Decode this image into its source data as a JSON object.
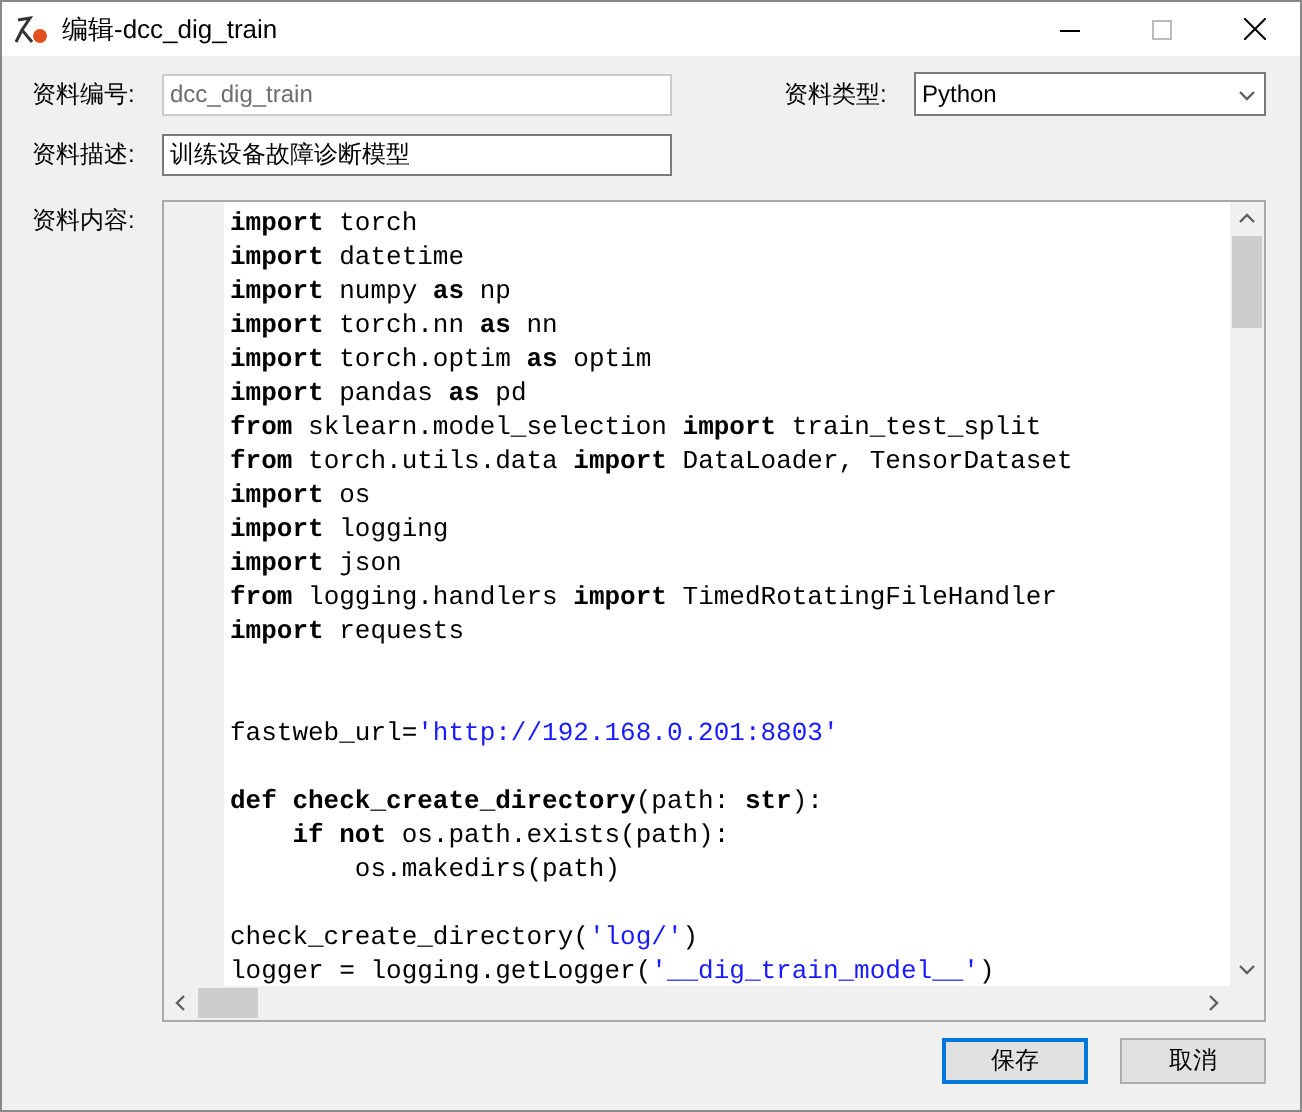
{
  "window": {
    "title": "编辑-dcc_dig_train"
  },
  "form": {
    "id_label": "资料编号:",
    "id_value": "dcc_dig_train",
    "id_disabled": true,
    "type_label": "资料类型:",
    "type_value": "Python",
    "desc_label": "资料描述:",
    "desc_value": "训练设备故障诊断模型",
    "content_label": "资料内容:"
  },
  "code_lines": [
    {
      "kind": "code",
      "tokens": [
        {
          "kind": "keyword",
          "text": "import"
        },
        {
          "kind": "plain",
          "text": " torch"
        }
      ]
    },
    {
      "kind": "code",
      "tokens": [
        {
          "kind": "keyword",
          "text": "import"
        },
        {
          "kind": "plain",
          "text": " datetime"
        }
      ]
    },
    {
      "kind": "code",
      "tokens": [
        {
          "kind": "keyword",
          "text": "import"
        },
        {
          "kind": "plain",
          "text": " numpy "
        },
        {
          "kind": "keyword",
          "text": "as"
        },
        {
          "kind": "plain",
          "text": " np"
        }
      ]
    },
    {
      "kind": "code",
      "tokens": [
        {
          "kind": "keyword",
          "text": "import"
        },
        {
          "kind": "plain",
          "text": " torch.nn "
        },
        {
          "kind": "keyword",
          "text": "as"
        },
        {
          "kind": "plain",
          "text": " nn"
        }
      ]
    },
    {
      "kind": "code",
      "tokens": [
        {
          "kind": "keyword",
          "text": "import"
        },
        {
          "kind": "plain",
          "text": " torch.optim "
        },
        {
          "kind": "keyword",
          "text": "as"
        },
        {
          "kind": "plain",
          "text": " optim"
        }
      ]
    },
    {
      "kind": "code",
      "tokens": [
        {
          "kind": "keyword",
          "text": "import"
        },
        {
          "kind": "plain",
          "text": " pandas "
        },
        {
          "kind": "keyword",
          "text": "as"
        },
        {
          "kind": "plain",
          "text": " pd"
        }
      ]
    },
    {
      "kind": "code",
      "tokens": [
        {
          "kind": "keyword",
          "text": "from"
        },
        {
          "kind": "plain",
          "text": " sklearn.model_selection "
        },
        {
          "kind": "keyword",
          "text": "import"
        },
        {
          "kind": "plain",
          "text": " train_test_split"
        }
      ]
    },
    {
      "kind": "code",
      "tokens": [
        {
          "kind": "keyword",
          "text": "from"
        },
        {
          "kind": "plain",
          "text": " torch.utils.data "
        },
        {
          "kind": "keyword",
          "text": "import"
        },
        {
          "kind": "plain",
          "text": " DataLoader, TensorDataset"
        }
      ]
    },
    {
      "kind": "code",
      "tokens": [
        {
          "kind": "keyword",
          "text": "import"
        },
        {
          "kind": "plain",
          "text": " os"
        }
      ]
    },
    {
      "kind": "code",
      "tokens": [
        {
          "kind": "keyword",
          "text": "import"
        },
        {
          "kind": "plain",
          "text": " logging"
        }
      ]
    },
    {
      "kind": "code",
      "tokens": [
        {
          "kind": "keyword",
          "text": "import"
        },
        {
          "kind": "plain",
          "text": " json"
        }
      ]
    },
    {
      "kind": "code",
      "tokens": [
        {
          "kind": "keyword",
          "text": "from"
        },
        {
          "kind": "plain",
          "text": " logging.handlers "
        },
        {
          "kind": "keyword",
          "text": "import"
        },
        {
          "kind": "plain",
          "text": " TimedRotatingFileHandler"
        }
      ]
    },
    {
      "kind": "code",
      "tokens": [
        {
          "kind": "keyword",
          "text": "import"
        },
        {
          "kind": "plain",
          "text": " requests"
        }
      ]
    },
    {
      "kind": "blank"
    },
    {
      "kind": "blank"
    },
    {
      "kind": "code",
      "tokens": [
        {
          "kind": "plain",
          "text": "fastweb_url="
        },
        {
          "kind": "string",
          "text": "'http://192.168.0.201:8803'"
        }
      ]
    },
    {
      "kind": "blank"
    },
    {
      "kind": "code",
      "tokens": [
        {
          "kind": "keyword",
          "text": "def check_create_directory"
        },
        {
          "kind": "plain",
          "text": "(path: "
        },
        {
          "kind": "keyword",
          "text": "str"
        },
        {
          "kind": "plain",
          "text": "):"
        }
      ]
    },
    {
      "kind": "code",
      "tokens": [
        {
          "kind": "keyword",
          "text": "    if not"
        },
        {
          "kind": "plain",
          "text": " os.path.exists(path):"
        }
      ]
    },
    {
      "kind": "code",
      "tokens": [
        {
          "kind": "plain",
          "text": "        os.makedirs(path)"
        }
      ]
    },
    {
      "kind": "blank"
    },
    {
      "kind": "code",
      "tokens": [
        {
          "kind": "plain",
          "text": "check_create_directory("
        },
        {
          "kind": "string",
          "text": "'log/'"
        },
        {
          "kind": "plain",
          "text": ")"
        }
      ]
    },
    {
      "kind": "code",
      "tokens": [
        {
          "kind": "plain",
          "text": "logger = logging.getLogger("
        },
        {
          "kind": "string",
          "text": "'__dig_train_model__'"
        },
        {
          "kind": "plain",
          "text": ")"
        }
      ]
    }
  ],
  "buttons": [
    {
      "label": "保存",
      "default": true
    },
    {
      "label": "取消",
      "default": false
    }
  ]
}
